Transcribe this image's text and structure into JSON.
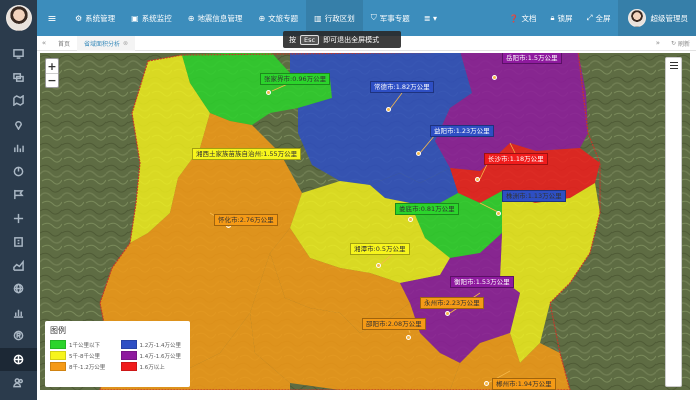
{
  "nav": {
    "items": [
      {
        "icon": "⚙",
        "label": "系统管理"
      },
      {
        "icon": "▣",
        "label": "系统监控"
      },
      {
        "icon": "⊕",
        "label": "地震信息管理"
      },
      {
        "icon": "⊕",
        "label": "文旅专题"
      },
      {
        "icon": "▥",
        "label": "行政区划"
      },
      {
        "icon": "⛉",
        "label": "军事专题"
      }
    ],
    "active_index": 4,
    "more_icon": "≣ ▾"
  },
  "top_right": {
    "docs": "文档",
    "lock": "锁屏",
    "fullscreen": "全屏",
    "user": "超级管理员"
  },
  "tabs": {
    "home": "首页",
    "current": "省域面积分析",
    "refresh": "刷新"
  },
  "toast": {
    "prefix": "按",
    "key": "Esc",
    "text": "即可退出全屏模式"
  },
  "map_labels": [
    {
      "text": "张家界市:0.96万公里",
      "color": "#2bd42b"
    },
    {
      "text": "常德市:1.82万公里",
      "color": "#2e4fc4"
    },
    {
      "text": "岳阳市:1.5万公里",
      "color": "#8e1a9e"
    },
    {
      "text": "湘西土家族苗族自治州:1.55万公里",
      "color": "#f7f51c"
    },
    {
      "text": "益阳市:1.23万公里",
      "color": "#2e4fc4"
    },
    {
      "text": "长沙市:1.18万公里",
      "color": "#f01c1c"
    },
    {
      "text": "株洲市:1.13万公里",
      "color": "#2e4fc4"
    },
    {
      "text": "娄底市:0.81万公里",
      "color": "#2bd42b"
    },
    {
      "text": "湘潭市:0.5万公里",
      "color": "#f7f51c"
    },
    {
      "text": "怀化市:2.76万公里",
      "color": "#f59a16"
    },
    {
      "text": "邵阳市:2.08万公里",
      "color": "#f59a16"
    },
    {
      "text": "衡阳市:1.53万公里",
      "color": "#8e1a9e"
    },
    {
      "text": "永州市:2.23万公里",
      "color": "#f59a16"
    },
    {
      "text": "郴州市:1.94万公里",
      "color": "#f59a16"
    }
  ],
  "legend": {
    "title": "图例",
    "items": [
      {
        "label": "1千公里以下",
        "color": "#2bd42b"
      },
      {
        "label": "1.2万-1.4万公里",
        "color": "#2e4fc4"
      },
      {
        "label": "5千-8千公里",
        "color": "#f7f51c"
      },
      {
        "label": "1.4万-1.6万公里",
        "color": "#8e1a9e"
      },
      {
        "label": "8千-1.2万公里",
        "color": "#f59a16"
      },
      {
        "label": "1.6万以上",
        "color": "#f01c1c"
      }
    ]
  }
}
